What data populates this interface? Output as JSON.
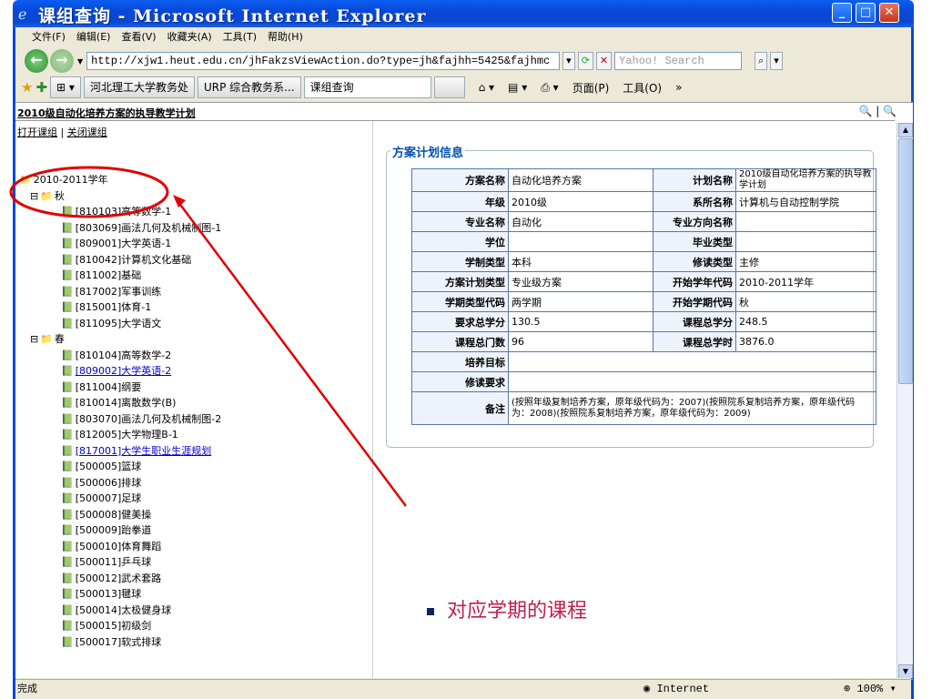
{
  "window": {
    "title": "课组查询 - Microsoft Internet Explorer",
    "min": "_",
    "max": "□",
    "close": "✕"
  },
  "menu": [
    "文件(F)",
    "编辑(E)",
    "查看(V)",
    "收藏夹(A)",
    "工具(T)",
    "帮助(H)"
  ],
  "address": {
    "url": "http://xjw1.heut.edu.cn/jhFakzsViewAction.do?type=jh&fajhh=5425&fajhmc",
    "search_placeholder": "Yahoo! Search"
  },
  "tabs": [
    "河北理工大学教务处",
    "URP 综合教务系...",
    "课组查询"
  ],
  "tab_tools": [
    "页面(P)",
    "工具(O)"
  ],
  "page": {
    "heading": "2010级自动化培养方案的执导教学计划",
    "open_group": "打开课组",
    "close_group": "关闭课组"
  },
  "tree": [
    {
      "level": 1,
      "icon": "folder",
      "text": "2010-2011学年"
    },
    {
      "level": 2,
      "icon": "folder-open",
      "text": "秋",
      "exp": "⊟"
    },
    {
      "level": 3,
      "text": "[810103]高等数学-1"
    },
    {
      "level": 3,
      "text": "[803069]画法几何及机械制图-1"
    },
    {
      "level": 3,
      "text": "[809001]大学英语-1"
    },
    {
      "level": 3,
      "text": "[810042]计算机文化基础"
    },
    {
      "level": 3,
      "text": "[811002]基础"
    },
    {
      "level": 3,
      "text": "[817002]军事训练"
    },
    {
      "level": 3,
      "text": "[815001]体育-1"
    },
    {
      "level": 3,
      "text": "[811095]大学语文"
    },
    {
      "level": 2,
      "icon": "folder-open",
      "text": "春",
      "exp": "⊟"
    },
    {
      "level": 3,
      "text": "[810104]高等数学-2"
    },
    {
      "level": 3,
      "text": "[809002]大学英语-2",
      "link": true
    },
    {
      "level": 3,
      "text": "[811004]纲要"
    },
    {
      "level": 3,
      "text": "[810014]离散数学(B)"
    },
    {
      "level": 3,
      "text": "[803070]画法几何及机械制图-2"
    },
    {
      "level": 3,
      "text": "[812005]大学物理B-1"
    },
    {
      "level": 3,
      "text": "[817001]大学生职业生涯规划",
      "link": true
    },
    {
      "level": 3,
      "text": "[500005]篮球"
    },
    {
      "level": 3,
      "text": "[500006]排球"
    },
    {
      "level": 3,
      "text": "[500007]足球"
    },
    {
      "level": 3,
      "text": "[500008]健美操"
    },
    {
      "level": 3,
      "text": "[500009]跆拳道"
    },
    {
      "level": 3,
      "text": "[500010]体育舞蹈"
    },
    {
      "level": 3,
      "text": "[500011]乒乓球"
    },
    {
      "level": 3,
      "text": "[500012]武术套路"
    },
    {
      "level": 3,
      "text": "[500013]毽球"
    },
    {
      "level": 3,
      "text": "[500014]太极健身球"
    },
    {
      "level": 3,
      "text": "[500015]初级剑"
    },
    {
      "level": 3,
      "text": "[500017]软式排球"
    }
  ],
  "info": {
    "legend": "方案计划信息",
    "rows": [
      [
        "方案名称",
        "自动化培养方案",
        "计划名称",
        "2010级自动化培养方案的执导教学计划"
      ],
      [
        "年级",
        "2010级",
        "系所名称",
        "计算机与自动控制学院"
      ],
      [
        "专业名称",
        "自动化",
        "专业方向名称",
        ""
      ],
      [
        "学位",
        "",
        "毕业类型",
        ""
      ],
      [
        "学制类型",
        "本科",
        "修读类型",
        "主修"
      ],
      [
        "方案计划类型",
        "专业级方案",
        "开始学年代码",
        "2010-2011学年"
      ],
      [
        "学期类型代码",
        "两学期",
        "开始学期代码",
        "秋"
      ],
      [
        "要求总学分",
        "130.5",
        "课程总学分",
        "248.5"
      ],
      [
        "课程总门数",
        "96",
        "课程总学时",
        "3876.0"
      ]
    ],
    "goal_label": "培养目标",
    "req_label": "修读要求",
    "remark_label": "备注",
    "remark": "(按照年级复制培养方案，原年级代码为：2007)(按照院系复制培养方案，原年级代码为：2008)(按照院系复制培养方案，原年级代码为：2009)"
  },
  "annotation": "对应学期的课程",
  "status": {
    "text": "完成",
    "zone": "Internet",
    "zoom": "100%"
  },
  "colors": {
    "titlebar": "#0848d8",
    "annotation": "#c0204a",
    "arrow": "#e00000"
  }
}
